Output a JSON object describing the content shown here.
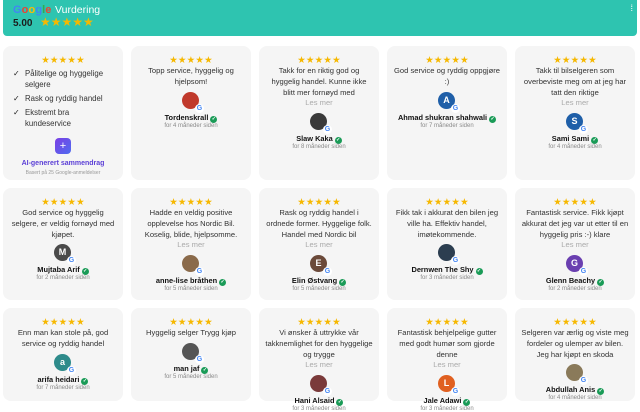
{
  "header": {
    "google_word": [
      "G",
      "o",
      "o",
      "g",
      "l",
      "e"
    ],
    "google_colors": [
      "#4285f4",
      "#ea4335",
      "#fbbc05",
      "#4285f4",
      "#34a853",
      "#ea4335"
    ],
    "title": "Vurdering",
    "score": "5.00",
    "stars": "★★★★★",
    "right_mark": "⁞"
  },
  "summary": {
    "stars": "★★★★★",
    "bullets": [
      "Pålitelige og hyggelige selgere",
      "Rask og ryddig handel",
      "Ekstremt bra kundeservice"
    ],
    "icon": "sparkle-icon",
    "label": "AI-generert sammendrag",
    "sub": "Basert på 25 Google-anmeldelser"
  },
  "reviews": [
    {
      "stars": "★★★★★",
      "text": "Topp service, hyggelig og hjelpsom!",
      "more": "",
      "name": "Tordenskrall",
      "date": "for 4 måneder siden",
      "initial": "",
      "color": "#c0392b"
    },
    {
      "stars": "★★★★★",
      "text": "Takk for en riktig god og hyggelig handel. Kunne ikke blitt mer fornøyd med",
      "more": "Les mer",
      "name": "Slaw Kaka",
      "date": "for 8 måneder siden",
      "initial": "",
      "color": "#3a3a3a"
    },
    {
      "stars": "★★★★★",
      "text": "God service og ryddig oppgjøre :)",
      "more": "",
      "name": "Ahmad shukran shahwali",
      "date": "for 7 måneder siden",
      "initial": "A",
      "color": "#1f5fa8"
    },
    {
      "stars": "★★★★★",
      "text": "Takk til bilselgeren som overbeviste meg om at jeg har tatt den riktige",
      "more": "Les mer",
      "name": "Sami Sami",
      "date": "for 4 måneder siden",
      "initial": "S",
      "color": "#1f5fa8"
    },
    {
      "stars": "★★★★★",
      "text": "God service og hyggelig selgere, er veldig fornøyd med kjøpet.",
      "more": "",
      "name": "Mujtaba Arif",
      "date": "for 2 måneder siden",
      "initial": "M",
      "color": "#4a4a4a"
    },
    {
      "stars": "★★★★★",
      "text": "Hadde en veldig positive opplevelse hos Nordic Bil. Koselig, blide, hjelpsomme.",
      "more": "Les mer",
      "name": "anne-lise bråthen",
      "date": "for 5 måneder siden",
      "initial": "",
      "color": "#8a6a4a"
    },
    {
      "stars": "★★★★★",
      "text": "Rask og ryddig handel i ordnede former. Hyggelige folk. Handel med Nordic bil",
      "more": "Les mer",
      "name": "Elin Østvang",
      "date": "for 5 måneder siden",
      "initial": "E",
      "color": "#6b4a3a"
    },
    {
      "stars": "★★★★★",
      "text": "Fikk tak i akkurat den bilen jeg ville ha. Effektiv handel, imøtekommende.",
      "more": "",
      "name": "Dernwen The Shy",
      "date": "for 3 måneder siden",
      "initial": "",
      "color": "#2c3e50"
    },
    {
      "stars": "★★★★★",
      "text": "Fantastisk service. Fikk kjøpt akkurat det jeg var ut etter til en hyggelig pris :-) klare",
      "more": "Les mer",
      "name": "Glenn Beachy",
      "date": "for 2 måneder siden",
      "initial": "G",
      "color": "#6a3fb0"
    },
    {
      "stars": "★★★★★",
      "text": "Enn man kan stole på, god service og ryddig handel",
      "more": "",
      "name": "arifa heidari",
      "date": "for 7 måneder siden",
      "initial": "a",
      "color": "#2e8b8b"
    },
    {
      "stars": "★★★★★",
      "text": "Hyggelig selger Trygg kjøp",
      "more": "",
      "name": "man jaf",
      "date": "for 5 måneder siden",
      "initial": "",
      "color": "#555555"
    },
    {
      "stars": "★★★★★",
      "text": "Vi ønsker å uttrykke vår takknemlighet for den hyggelige og trygge",
      "more": "Les mer",
      "name": "Hani Alsaid",
      "date": "for 3 måneder siden",
      "initial": "",
      "color": "#7a3a3a"
    },
    {
      "stars": "★★★★★",
      "text": "Fantastisk behjelpelige gutter med godt humør som gjorde denne",
      "more": "Les mer",
      "name": "Jale Adawi",
      "date": "for 3 måneder siden",
      "initial": "L",
      "color": "#e06020"
    },
    {
      "stars": "★★★★★",
      "text": "Selgeren var ærlig og viste meg fordeler og ulemper av bilen. Jeg har kjøpt en skoda",
      "more": "",
      "name": "Abdullah Anis",
      "date": "for 4 måneder siden",
      "initial": "",
      "color": "#8a7a5a"
    }
  ]
}
